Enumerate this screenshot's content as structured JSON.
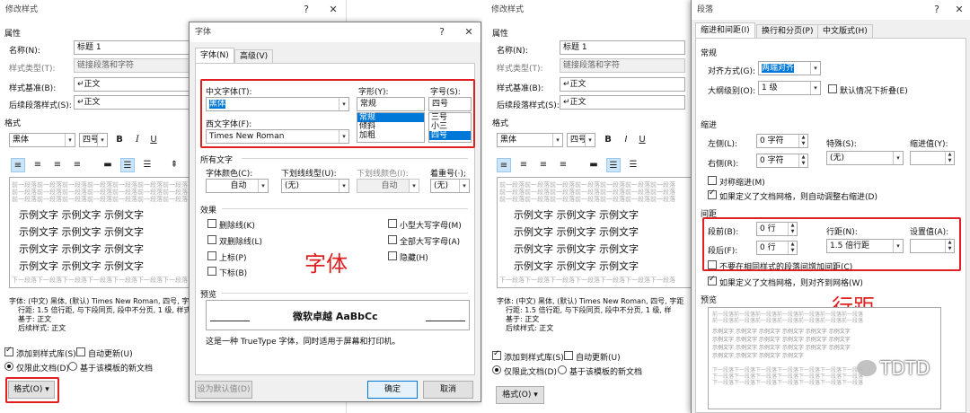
{
  "left_dialog": {
    "title": "修改样式",
    "section_properties": "属性",
    "name_label": "名称(N):",
    "name_value": "标题 1",
    "style_type_label": "样式类型(T):",
    "style_type_value": "链接段落和字符",
    "based_on_label": "样式基准(B):",
    "based_on_value": "↵正文",
    "next_style_label": "后续段落样式(S):",
    "next_style_value": "↵正文",
    "section_format": "格式",
    "font_value": "黑体",
    "size_value": "四号",
    "bold": "B",
    "italic": "I",
    "underline": "U",
    "preview_prev": "前一段落前一段落前一段落前一段落前一段落前一段落前一段落",
    "sample_text": "示例文字",
    "preview_next": "下一段落下一段落下一段落下一段落下一段落下一段落下一段落",
    "description_lines": [
      "字体: (中文) 黑体, (默认) Times New Roman, 四号, 字",
      "行距: 1.5 倍行距, 与下段同页, 段中不分页, 1 级, 样式",
      "基于: 正文",
      "后续样式: 正文"
    ],
    "add_to_gallery": "添加到样式库(S)",
    "auto_update": "自动更新(U)",
    "only_this_doc": "仅限此文档(D)",
    "new_docs_template": "基于该模板的新文档",
    "format_button": "格式(O) ▾"
  },
  "font_dialog": {
    "title": "字体",
    "tab_font": "字体(N)",
    "tab_advanced": "高级(V)",
    "chinese_font_label": "中文字体(T):",
    "chinese_font_value": "黑体",
    "western_font_label": "西文字体(F):",
    "western_font_value": "Times New Roman",
    "style_label": "字形(Y):",
    "style_value": "常规",
    "style_options": [
      "常规",
      "倾斜",
      "加粗"
    ],
    "size_label": "字号(S):",
    "size_value": "四号",
    "size_options": [
      "三号",
      "小三",
      "四号"
    ],
    "all_text_label": "所有文字",
    "font_color_label": "字体颜色(C):",
    "font_color_value": "自动",
    "underline_type_label": "下划线线型(U):",
    "underline_type_value": "(无)",
    "underline_color_label": "下划线颜色(I):",
    "underline_color_value": "自动",
    "emphasis_label": "着重号(·);",
    "emphasis_value": "(无)",
    "effects_label": "效果",
    "effects": [
      "删除线(K)",
      "双删除线(L)",
      "上标(P)",
      "下标(B)"
    ],
    "effects_right": [
      "小型大写字母(M)",
      "全部大写字母(A)",
      "隐藏(H)"
    ],
    "annotation": "字体",
    "preview_label": "预览",
    "preview_text": "微软卓越  AaBbCc",
    "truetype_note": "这是一种 TrueType 字体，同时适用于屏幕和打印机。",
    "set_default": "设为默认值(D)",
    "ok": "确定",
    "cancel": "取消"
  },
  "right_dialog": {
    "title": "修改样式",
    "section_properties": "属性",
    "name_label": "名称(N):",
    "name_value": "标题 1",
    "style_type_label": "样式类型(T):",
    "style_type_value": "链接段落和字符",
    "based_on_label": "样式基准(B):",
    "based_on_value": "↵正文",
    "next_style_label": "后续段落样式(S):",
    "next_style_value": "↵正文",
    "section_format": "格式",
    "font_value": "黑体",
    "size_value": "四号",
    "description_lines": [
      "字体: (中文) 黑体, (默认) Times New Roman, 四号, 字距",
      "行距: 1.5 倍行距, 与下段同页, 段中不分页, 1 级, 样",
      "基于: 正文",
      "后续样式: 正文"
    ],
    "add_to_gallery": "添加到样式库(S)",
    "auto_update": "自动更新(U)",
    "only_this_doc": "仅限此文档(D)",
    "new_docs_template": "基于该模板的新文档",
    "format_button": "格式(O) ▾"
  },
  "para_dialog": {
    "title": "段落",
    "tab_indent": "缩进和间距(I)",
    "tab_breaks": "换行和分页(P)",
    "tab_chinese": "中文版式(H)",
    "general_label": "常规",
    "alignment_label": "对齐方式(G):",
    "alignment_value": "两端对齐",
    "outline_label": "大纲级别(O):",
    "outline_value": "1 级",
    "collapse_default": "默认情况下折叠(E)",
    "indent_label": "缩进",
    "left_label": "左侧(L):",
    "left_value": "0 字符",
    "right_label": "右侧(R):",
    "right_value": "0 字符",
    "special_label": "特殊(S):",
    "special_value": "(无)",
    "indent_by_label": "缩进值(Y):",
    "mirror_indents": "对称缩进(M)",
    "auto_adjust_right": "如果定义了文档网格，则自动调整右缩进(D)",
    "spacing_label": "间距",
    "before_label": "段前(B):",
    "before_value": "0 行",
    "after_label": "段后(F):",
    "after_value": "0 行",
    "line_spacing_label": "行距(N):",
    "line_spacing_value": "1.5 倍行距",
    "at_label": "设置值(A):",
    "dont_add_space": "不要在相同样式的段落间增加间距(C)",
    "snap_to_grid": "如果定义了文档网格，则对齐到网格(W)",
    "annotation": "行距",
    "preview_label": "预览",
    "watermark": "TDTD"
  },
  "colors": {
    "accent": "#0078d7",
    "annotation_red": "#e02020"
  }
}
